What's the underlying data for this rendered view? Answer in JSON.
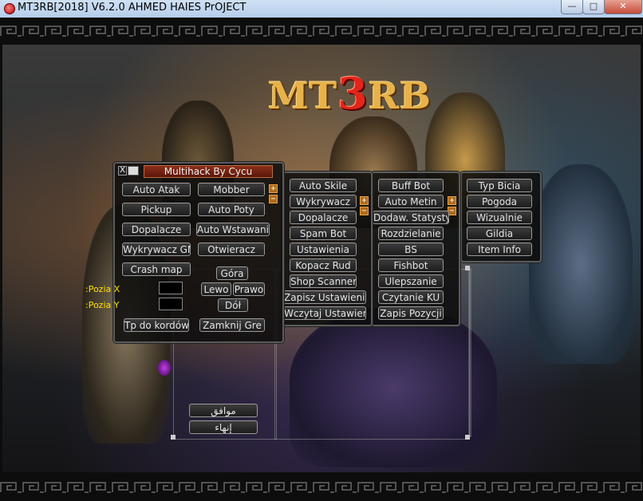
{
  "window": {
    "title": "MT3RB[2018] V6.2.0 AHMED HAIES PrOJECT",
    "minimize": "—",
    "maximize": "□",
    "close": "✕"
  },
  "logo": {
    "part1": "MT",
    "part2": "3",
    "part3": "RB"
  },
  "main_panel": {
    "title": "Multihack By Cycu",
    "close": "X",
    "buttons_left": [
      "Auto Atak",
      "Pickup",
      "Dopalacze",
      "Wykrywacz GM",
      "Crash map"
    ],
    "buttons_right": [
      "Mobber",
      "Auto Poty",
      "Auto Wstawanie",
      "Otwieracz"
    ],
    "plus": "+",
    "minus": "−",
    "gora": "Góra",
    "lewo": "Lewo",
    "prawo": "Prawo",
    "dol": "Dół",
    "pos_x_label": ":Pozia X",
    "pos_y_label": ":Pozia Y",
    "tp_button": "Tp do kordów",
    "close_game": "Zamknij Gre"
  },
  "panel2": {
    "buttons": [
      "Auto Skile",
      "Wykrywacz",
      "Dopalacze",
      "Spam Bot",
      "Ustawienia",
      "Kopacz Rud",
      "Shop Scanner",
      "Zapisz Ustawienia",
      "Wczytaj Ustawienia"
    ]
  },
  "panel3": {
    "buttons": [
      "Buff Bot",
      "Auto Metin",
      "Dodaw. Statystyk",
      "Rozdzielanie",
      "BS",
      "Fishbot",
      "Ulepszanie",
      "Czytanie KU",
      "Zapis Pozycji"
    ]
  },
  "panel4": {
    "buttons": [
      "Typ Bicia",
      "Pogoda",
      "Wizualnie",
      "Gildia",
      "Item Info"
    ]
  },
  "dialog": {
    "ok": "موافق",
    "end": "إنهاء"
  }
}
